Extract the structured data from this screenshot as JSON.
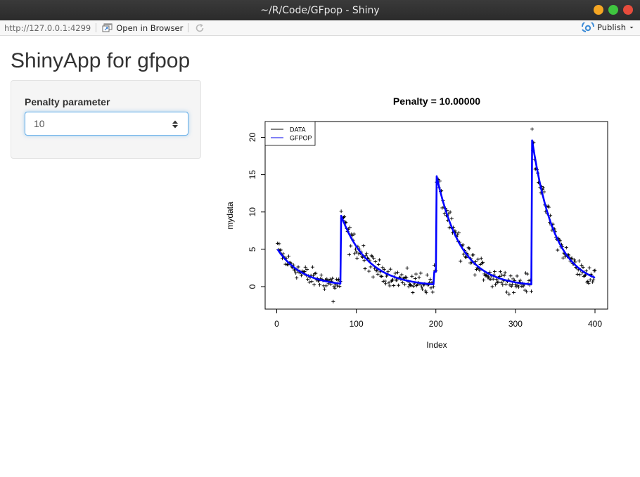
{
  "window": {
    "title": "~/R/Code/GFpop - Shiny",
    "buttons": [
      {
        "name": "minimize",
        "color": "#f5a623"
      },
      {
        "name": "maximize",
        "color": "#3fc53f"
      },
      {
        "name": "close",
        "color": "#e74c3c"
      }
    ]
  },
  "toolbar": {
    "url": "http://127.0.0.1:4299",
    "open_in_browser": "Open in Browser",
    "publish": "Publish",
    "publish_color": "#3a8ad6"
  },
  "app": {
    "title": "ShinyApp for gfpop",
    "penalty_label": "Penalty parameter",
    "penalty_value": "10"
  },
  "chart_data": {
    "type": "line",
    "title": "Penalty =  10.00000",
    "xlabel": "Index",
    "ylabel": "mydata",
    "xlim": [
      0,
      400
    ],
    "ylim": [
      -2,
      21
    ],
    "xticks": [
      "0",
      "100",
      "200",
      "300",
      "400"
    ],
    "yticks": [
      "0",
      "5",
      "10",
      "15",
      "20"
    ],
    "legend": {
      "position": "top-left",
      "entries": [
        {
          "label": "DATA",
          "color": "#000000"
        },
        {
          "label": "GFPOP",
          "color": "#0000ee"
        }
      ]
    },
    "series": [
      {
        "name": "GFPOP",
        "color": "#0000ff",
        "segments": [
          {
            "x": [
              1,
              80
            ],
            "decay": {
              "start": 5.0,
              "end": 0.4
            }
          },
          {
            "x": [
              81,
              197
            ],
            "decay": {
              "start": 9.5,
              "end": 0.3
            }
          },
          {
            "x": [
              198,
              200
            ],
            "decay": {
              "start": 2.0,
              "end": 2.0
            }
          },
          {
            "x": [
              201,
              320
            ],
            "decay": {
              "start": 14.8,
              "end": 0.3
            }
          },
          {
            "x": [
              321,
              400
            ],
            "decay": {
              "start": 19.6,
              "end": 1.2
            }
          }
        ]
      },
      {
        "name": "DATA",
        "marker": "+",
        "color": "#000000",
        "y_sample_every_10": [
          5.8,
          3.0,
          2.9,
          1.5,
          0.6,
          1.1,
          0.9,
          -2.0,
          10.1,
          4.3,
          3.8,
          2.4,
          1.3,
          1.4,
          0.5,
          0.9,
          0.3,
          -0.8,
          1.8,
          0.3,
          14.0,
          9.8,
          7.2,
          3.4,
          5.2,
          2.3,
          1.7,
          0.0,
          2.0,
          0.9,
          0.0,
          0.3,
          21.1,
          13.3,
          10.8,
          6.6,
          4.5,
          3.8,
          1.6,
          0.7
        ]
      }
    ]
  }
}
